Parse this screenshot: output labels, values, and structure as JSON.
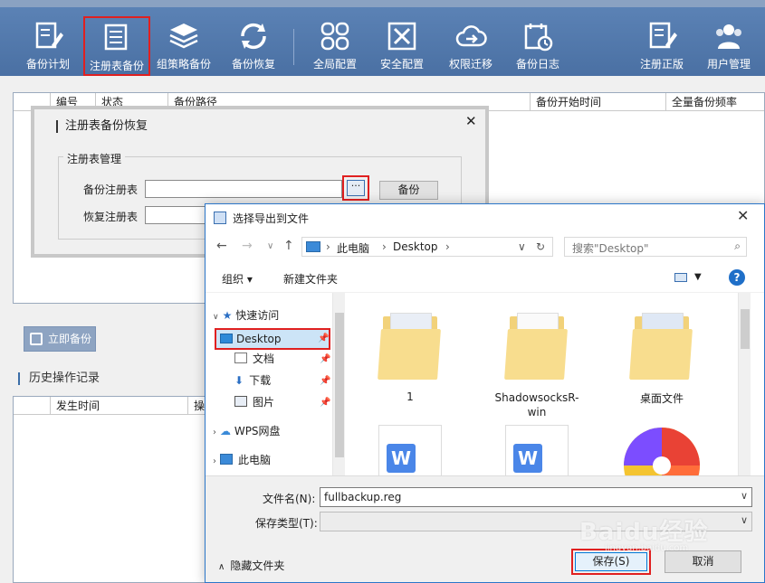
{
  "toolbar": {
    "items": [
      {
        "label": "备份计划",
        "icon": "edit-list-icon"
      },
      {
        "label": "注册表备份",
        "icon": "document-list-icon",
        "active": true
      },
      {
        "label": "组策略备份",
        "icon": "layers-icon"
      },
      {
        "label": "备份恢复",
        "icon": "sync-icon"
      },
      {
        "label": "全局配置",
        "icon": "grid-icon"
      },
      {
        "label": "安全配置",
        "icon": "tools-icon"
      },
      {
        "label": "权限迁移",
        "icon": "cloud-arrow-icon"
      },
      {
        "label": "备份日志",
        "icon": "calendar-clock-icon"
      },
      {
        "label": "注册正版",
        "icon": "edit-list-icon"
      },
      {
        "label": "用户管理",
        "icon": "users-icon"
      }
    ]
  },
  "main": {
    "table1_headers": [
      "编号",
      "状态",
      "备份路径",
      "备份开始时间",
      "全量备份频率"
    ],
    "backup_now": "立即备份",
    "history_title": "历史操作记录",
    "table2_headers": [
      "发生时间",
      "操"
    ]
  },
  "reg_dialog": {
    "title": "注册表备份恢复",
    "group": "注册表管理",
    "backup_label": "备份注册表",
    "restore_label": "恢复注册表",
    "dots": "···",
    "backup_button": "备份"
  },
  "file_dialog": {
    "title": "选择导出到文件",
    "path": [
      "此电脑",
      "Desktop"
    ],
    "search_placeholder": "搜索\"Desktop\"",
    "organize": "组织 ▾",
    "new_folder": "新建文件夹",
    "help": "?",
    "nav": {
      "quick_access": "快速访问",
      "desktop": "Desktop",
      "documents": "文档",
      "downloads": "下载",
      "pictures": "图片",
      "wps": "WPS网盘",
      "this_pc": "此电脑"
    },
    "files": [
      {
        "name": "1",
        "type": "folder"
      },
      {
        "name": "ShadowsocksR-win",
        "type": "folder"
      },
      {
        "name": "桌面文件",
        "type": "folder"
      }
    ],
    "filename_label": "文件名(N):",
    "filename_value": "fullbackup.reg",
    "filetype_label": "保存类型(T):",
    "hide_folders": "隐藏文件夹",
    "save": "保存(S)",
    "cancel": "取消"
  },
  "watermark": {
    "brand": "Baidu经验",
    "sub": "jingyan.baidu.com"
  },
  "colors": {
    "toolbar": "#4a70a3",
    "highlight": "#e02020",
    "accent": "#0078d7"
  }
}
